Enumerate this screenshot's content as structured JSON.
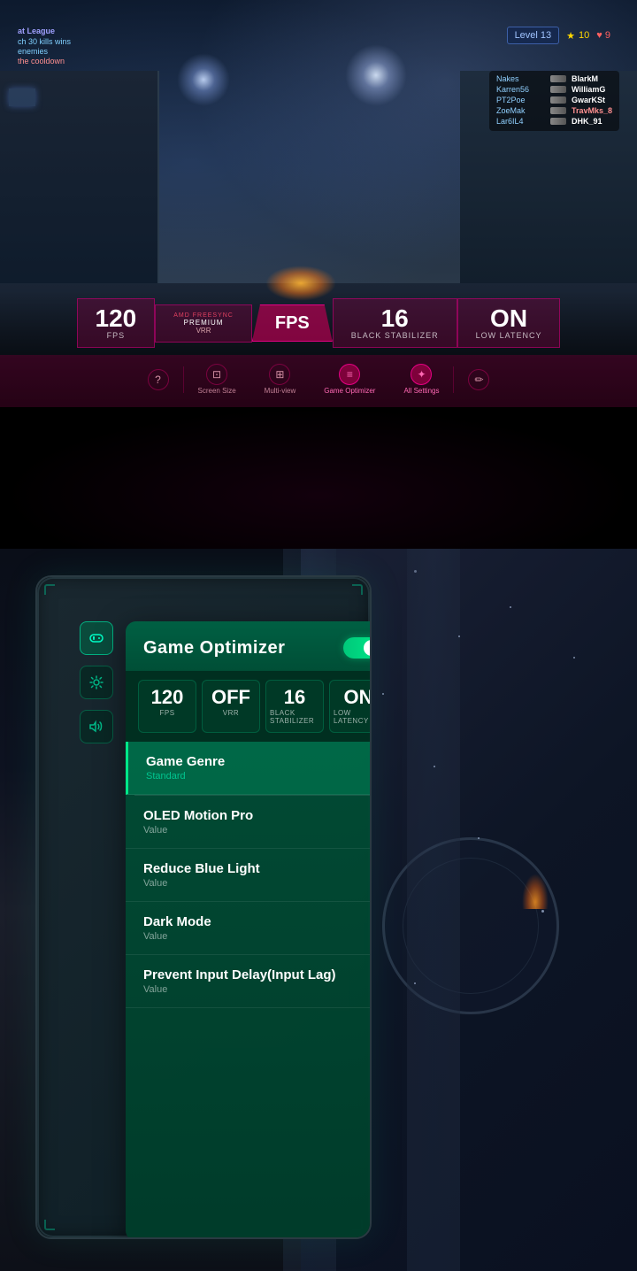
{
  "top": {
    "hud": {
      "level": "Level 13",
      "score": "10",
      "lives": "9"
    },
    "scoreboard": {
      "title": "at League",
      "players": [
        {
          "name": "Nakes",
          "alias": "BlarkM",
          "kills": ""
        },
        {
          "name": "Karren56",
          "alias": "WilliamG",
          "kills": ""
        },
        {
          "name": "PT2Poe",
          "alias": "GwarKSt",
          "kills": ""
        },
        {
          "name": "ZoeMak",
          "alias": "TravMks_8",
          "kills": ""
        },
        {
          "name": "Lar6IL4",
          "alias": "DHK_91",
          "kills": ""
        }
      ]
    },
    "kill_feed": {
      "title": "at League",
      "lines": [
        "ch 30 kills wins",
        "enemies",
        "the cooldown"
      ]
    },
    "stats": [
      {
        "number": "120",
        "label": "FPS",
        "sub": ""
      },
      {
        "number": "",
        "label": "FreeSync",
        "sub": "VRR",
        "logo": "AMD FreeSync Premium"
      },
      {
        "number": "FPS",
        "label": "",
        "sub": "",
        "active": true
      },
      {
        "number": "16",
        "label": "Black Stabilizer",
        "sub": ""
      },
      {
        "number": "ON",
        "label": "Low Latency",
        "sub": ""
      }
    ],
    "menu": [
      {
        "icon": "?",
        "label": ""
      },
      {
        "icon": "□",
        "label": "Screen Size"
      },
      {
        "icon": "⊞",
        "label": "Multi-view"
      },
      {
        "icon": "≡",
        "label": "Game Optimizer",
        "active": true
      },
      {
        "icon": "✦",
        "label": "All Settings",
        "active": true
      },
      {
        "icon": "✏",
        "label": ""
      }
    ]
  },
  "bottom": {
    "optimizer": {
      "title": "Game Optimizer",
      "toggle_on": true,
      "stats": [
        {
          "number": "120",
          "label": "FPS"
        },
        {
          "number": "OFF",
          "label": "VRR"
        },
        {
          "number": "16",
          "label": "Black Stabilizer"
        },
        {
          "number": "ON",
          "label": "Low Latency"
        }
      ],
      "menu_items": [
        {
          "title": "Game Genre",
          "sub": "Standard",
          "highlighted": true
        },
        {
          "title": "OLED Motion Pro",
          "sub": "Value"
        },
        {
          "title": "Reduce Blue Light",
          "sub": "Value"
        },
        {
          "title": "Dark Mode",
          "sub": "Value"
        },
        {
          "title": "Prevent Input Delay(Input Lag)",
          "sub": "Value"
        }
      ]
    },
    "side_icons": [
      {
        "icon": "🎮",
        "label": "gamepad",
        "active": true
      },
      {
        "icon": "✦",
        "label": "settings"
      },
      {
        "icon": "🔊",
        "label": "volume"
      }
    ]
  }
}
